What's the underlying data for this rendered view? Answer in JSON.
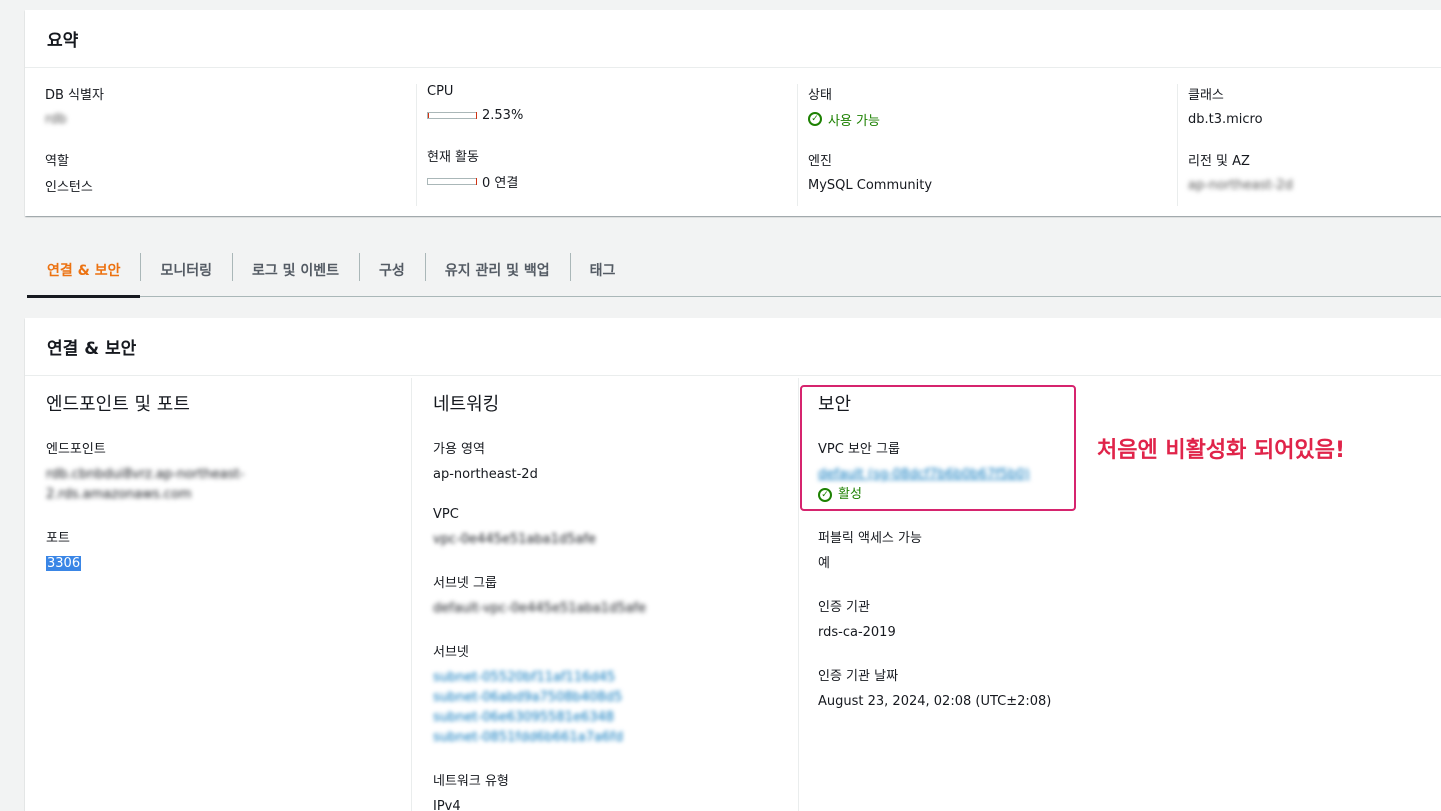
{
  "summary": {
    "title": "요약",
    "db_identifier_label": "DB 식별자",
    "db_identifier_value": "rdb",
    "cpu_label": "CPU",
    "cpu_value": "2.53%",
    "cpu_percent": 2.53,
    "status_label": "상태",
    "status_value": "사용 가능",
    "class_label": "클래스",
    "class_value": "db.t3.micro",
    "role_label": "역할",
    "role_value": "인스턴스",
    "activity_label": "현재 활동",
    "activity_value": "0 연결",
    "engine_label": "엔진",
    "engine_value": "MySQL Community",
    "region_label": "리전 및 AZ",
    "region_value": "ap-northeast-2d"
  },
  "tabs": [
    {
      "label": "연결 & 보안",
      "active": true
    },
    {
      "label": "모니터링",
      "active": false
    },
    {
      "label": "로그 및 이벤트",
      "active": false
    },
    {
      "label": "구성",
      "active": false
    },
    {
      "label": "유지 관리 및 백업",
      "active": false
    },
    {
      "label": "태그",
      "active": false
    }
  ],
  "connectivity": {
    "title": "연결 & 보안",
    "endpoint_section": {
      "heading": "엔드포인트 및 포트",
      "endpoint_label": "엔드포인트",
      "endpoint_value_line1": "rdb.cbnbdui8vrz.ap-northeast-",
      "endpoint_value_line2": "2.rds.amazonaws.com",
      "port_label": "포트",
      "port_value": "3306"
    },
    "networking_section": {
      "heading": "네트워킹",
      "az_label": "가용 영역",
      "az_value": "ap-northeast-2d",
      "vpc_label": "VPC",
      "vpc_value": "vpc-0e445e51aba1d5afe",
      "subnet_group_label": "서브넷 그룹",
      "subnet_group_value": "default-vpc-0e445e51aba1d5afe",
      "subnets_label": "서브넷",
      "subnets": [
        "subnet-05520bf11af116d45",
        "subnet-06abd9a7508b408d5",
        "subnet-06e63095581e6348",
        "subnet-0851fdd6b661a7a6fd"
      ],
      "network_type_label": "네트워크 유형",
      "network_type_value": "IPv4"
    },
    "security_section": {
      "heading": "보안",
      "vpc_sg_label": "VPC 보안 그룹",
      "vpc_sg_value": "default (sg-08dcf7b6b0b67f5b0)",
      "vpc_sg_status": "활성",
      "public_access_label": "퍼블릭 액세스 가능",
      "public_access_value": "예",
      "ca_label": "인증 기관",
      "ca_value": "rds-ca-2019",
      "ca_date_label": "인증 기관 날짜",
      "ca_date_value": "August 23, 2024, 02:08 (UTC±2:08)"
    }
  },
  "annotation": {
    "text": "처음엔 비활성화 되어있음!"
  },
  "colors": {
    "active_tab": "#ec7211",
    "success": "#1d8102",
    "link": "#0073bb",
    "annotation": "#e0244a"
  }
}
